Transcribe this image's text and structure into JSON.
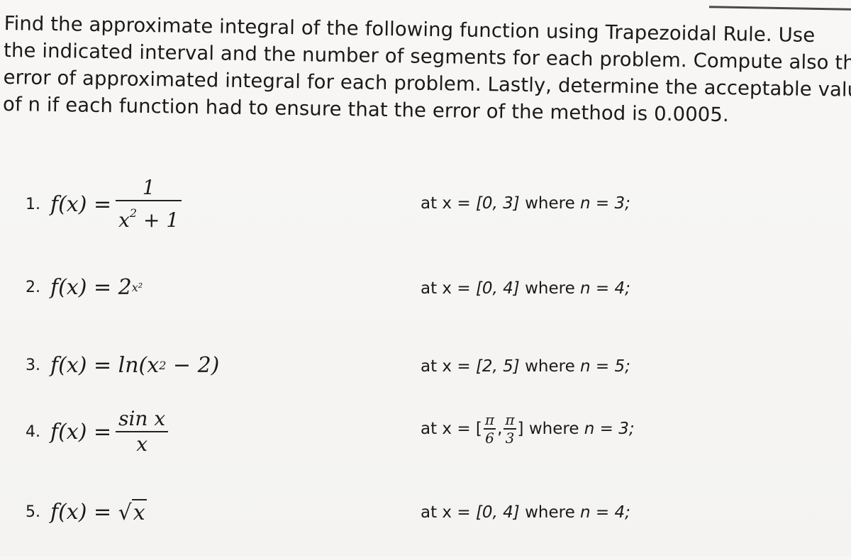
{
  "instructions": {
    "lines": [
      "Find the approximate integral of the following function using Trapezoidal Rule. Use",
      "the indicated interval and the number of segments for each problem. Compute also the",
      "error of approximated integral for each problem. Lastly, determine the acceptable value",
      "of n if each function had to ensure that the error of the method is 0.0005."
    ]
  },
  "problems": [
    {
      "number": "1.",
      "lhs": "f(x) =",
      "numerator": "1",
      "denominator_base": "x",
      "denominator_exp": "2",
      "denominator_rest": " + 1",
      "interval_prefix": "at x = ",
      "interval": "[0, 3]",
      "where": " where ",
      "n_var": "n",
      "n_eq": " = 3;"
    },
    {
      "number": "2.",
      "lhs": "f(x) = ",
      "base": "2",
      "exponent": "x²",
      "interval_prefix": "at x = ",
      "interval": "[0, 4]",
      "where": " where ",
      "n_var": "n",
      "n_eq": " = 4;"
    },
    {
      "number": "3.",
      "lhs": "f(x) = ",
      "expr_pre": "ln(x",
      "expr_exp": "2",
      "expr_post": " − 2)",
      "interval_prefix": "at x = ",
      "interval": "[2, 5]",
      "where": " where ",
      "n_var": "n",
      "n_eq": " = 5;"
    },
    {
      "number": "4.",
      "lhs": "f(x) =",
      "numerator": "sin x",
      "denominator": "x",
      "interval_prefix": "at x = [",
      "lower_num": "π",
      "lower_den": "6",
      "comma": ",",
      "upper_num": "π",
      "upper_den": "3",
      "interval_close": "]",
      "where": " where ",
      "n_var": "n",
      "n_eq": " = 3;"
    },
    {
      "number": "5.",
      "lhs": "f(x) = ",
      "radical": "√",
      "radicand": "x",
      "interval_prefix": "at x = ",
      "interval": "[0, 4]",
      "where": " where ",
      "n_var": "n",
      "n_eq": " = 4;"
    }
  ]
}
